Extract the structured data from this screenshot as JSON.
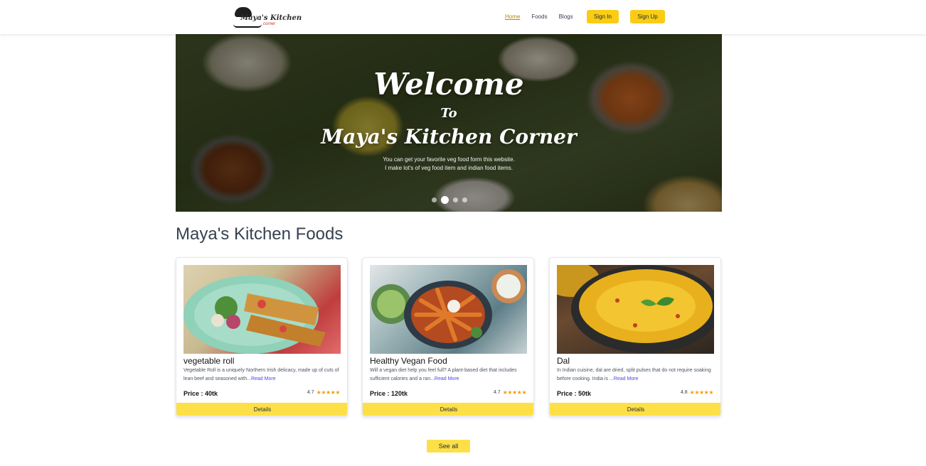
{
  "nav": {
    "logo_text": "Maya's Kitchen",
    "logo_sub": "corner",
    "links": [
      "Home",
      "Foods",
      "Blogs"
    ],
    "sign_in": "Sign In",
    "sign_up": "Sign Up"
  },
  "hero": {
    "line1": "Welcome",
    "line2": "To",
    "line3": "Maya's Kitchen Corner",
    "desc1": "You can get your favorite veg food form this website.",
    "desc2": "I make lot's of veg food item and indian food items.",
    "slides": 4,
    "active_slide": 2
  },
  "section_title": "Maya's Kitchen Foods",
  "foods": [
    {
      "name": "vegetable roll",
      "desc": "Vegetable Roll is a uniquely Northern Irish delicacy, made up of cuts of lean beef and seasoned with...",
      "read_more": "Read More",
      "price": "Price : 40tk",
      "rating": "4.7",
      "stars": "★★★★★",
      "button": "Details"
    },
    {
      "name": "Healthy Vegan Food",
      "desc": "Will a vegan diet help you feel full? A plant-based diet that includes sufficient calories and a ran...",
      "read_more": "Read More",
      "price": "Price : 120tk",
      "rating": "4.7",
      "stars": "★★★★★",
      "button": "Details"
    },
    {
      "name": "Dal",
      "desc": "In Indian cuisine, dal are dried, split pulses that do not require soaking before cooking. India is ...",
      "read_more": "Read More",
      "price": "Price : 50tk",
      "rating": "4.8",
      "stars": "★★★★★",
      "button": "Details"
    }
  ],
  "see_all": "See all",
  "colors": {
    "accent": "#facc15",
    "button_bg": "#fde047",
    "active_link": "#b8860b",
    "read_more": "#4f46e5",
    "star": "#f59e0b"
  }
}
